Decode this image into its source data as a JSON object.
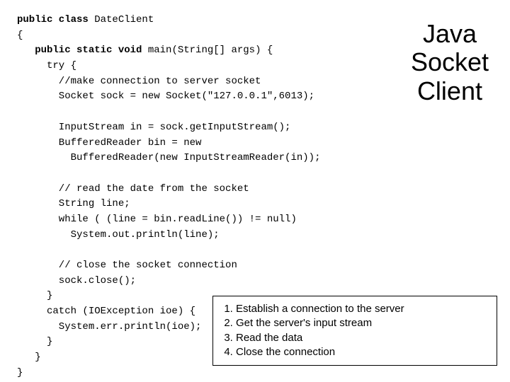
{
  "title": {
    "line1": "Java",
    "line2": "Socket",
    "line3": "Client"
  },
  "code": {
    "l1_kw": "public class ",
    "l1_name": "DateClient",
    "l2": "{",
    "l3_a": "   public static void ",
    "l3_b": "main(String[] args) {",
    "l4": "     try {",
    "l5": "       //make connection to server socket",
    "l6": "       Socket sock = new Socket(\"127.0.0.1\",6013);",
    "blank": "",
    "l7": "       InputStream in = sock.getInputStream();",
    "l8": "       BufferedReader bin = new",
    "l9": "         BufferedReader(new InputStreamReader(in));",
    "l10": "       // read the date from the socket",
    "l11": "       String line;",
    "l12": "       while ( (line = bin.readLine()) != null)",
    "l13": "         System.out.println(line);",
    "l14": "       // close the socket connection",
    "l15": "       sock.close();",
    "l16": "     }",
    "l17": "     catch (IOException ioe) {",
    "l18": "       System.err.println(ioe);",
    "l19": "     }",
    "l20": "   }",
    "l21": "}"
  },
  "steps": {
    "s1": "Establish a connection to the server",
    "s2": "Get the server's input stream",
    "s3": "Read the data",
    "s4": "Close the connection"
  }
}
